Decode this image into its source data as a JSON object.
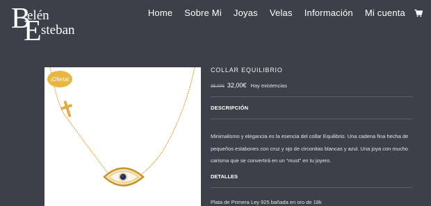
{
  "brand": {
    "line1": "elén",
    "line2": "steban"
  },
  "nav": {
    "items": [
      "Home",
      "Sobre Mi",
      "Joyas",
      "Velas",
      "Información",
      "Mi cuenta"
    ],
    "cart_icon": "cart-icon"
  },
  "product": {
    "badge": "¡Oferta!",
    "title": "COLLAR EQUILIBRIO",
    "old_price": "35,00€",
    "new_price": "32,00€",
    "stock": "Hay existencias",
    "description_heading": "DESCRIPCIÓN",
    "description": "Minimalismo y elegancia es la esencia del collar Equilibrio. Una cadena fina hecha de pequeños eslabones con cruz y ojo de circonitas blancas y azul. Una joya con mucho carisma que se convertirá en un “must” en tu joyero.",
    "details_heading": "DETALLES",
    "details": "Plata de Primera Ley 925 bañada en oro de 18k"
  },
  "colors": {
    "background": "#3d4049",
    "badge": "#e8b53e",
    "gold": "#d9a23a"
  }
}
